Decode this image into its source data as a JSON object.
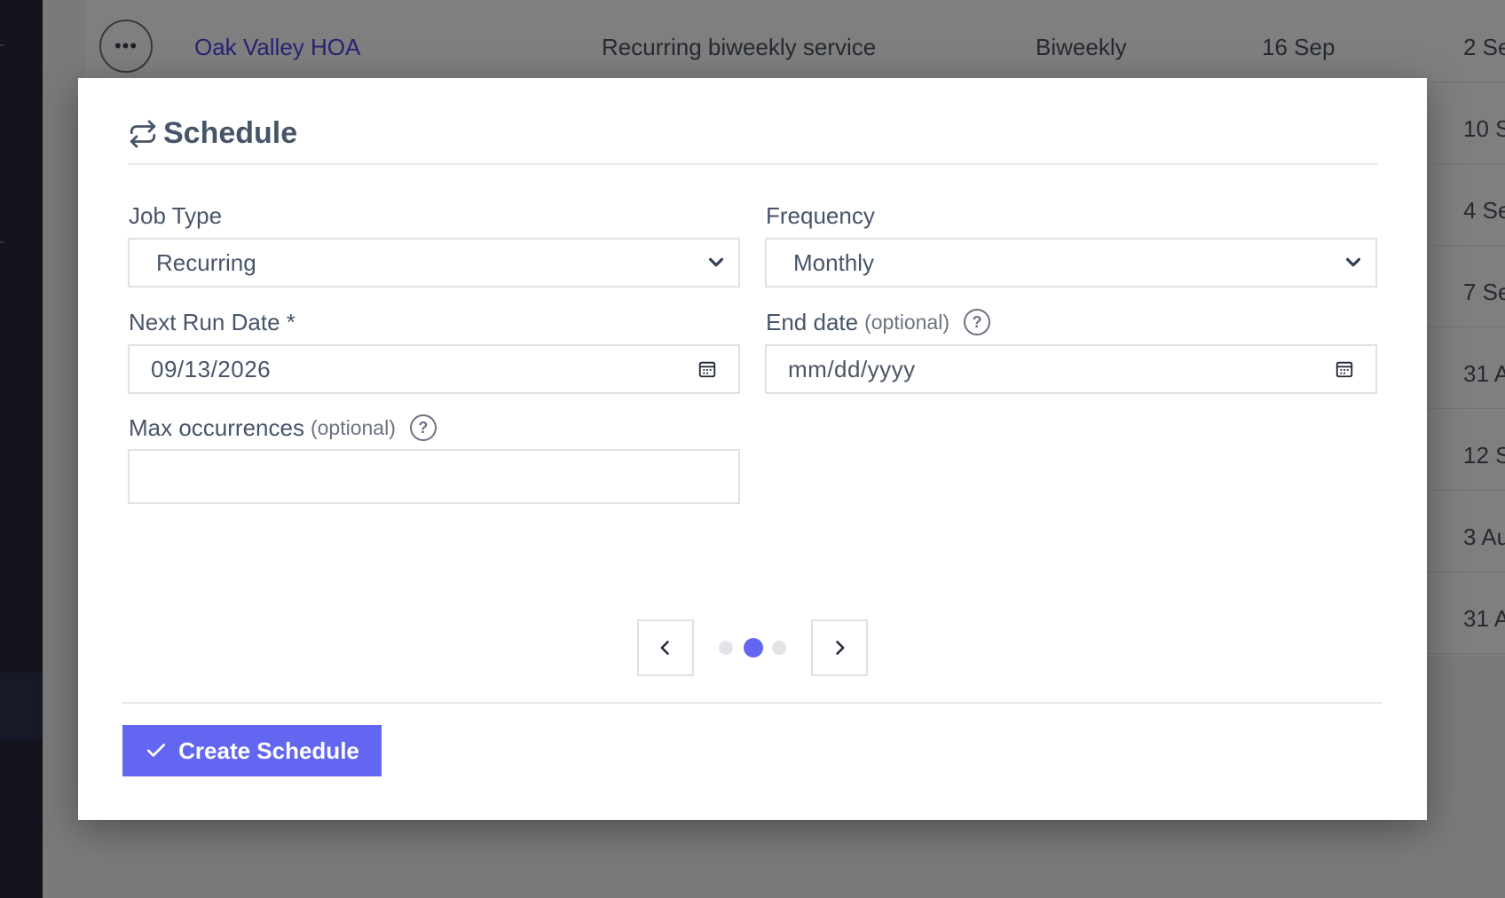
{
  "background": {
    "rows": [
      {
        "customer": "Oak Valley HOA",
        "description": "Recurring biweekly service",
        "frequency": "Biweekly",
        "next_run": "16 Sep",
        "last_cell": "2 Se"
      },
      {
        "last_cell": "10 S"
      },
      {
        "last_cell": "4 Se"
      },
      {
        "last_cell": "7 Se"
      },
      {
        "last_cell": "31 A"
      },
      {
        "last_cell": "12 S"
      },
      {
        "last_cell": "3 Au"
      },
      {
        "last_cell": "31 A"
      }
    ]
  },
  "modal": {
    "title": "Schedule",
    "title_icon": "repeat-icon",
    "job_type": {
      "label": "Job Type",
      "value": "Recurring"
    },
    "frequency": {
      "label": "Frequency",
      "value": "Monthly"
    },
    "next_run_date": {
      "label": "Next Run Date *",
      "value": "09/13/2026"
    },
    "end_date": {
      "label": "End date",
      "optional": "(optional)",
      "placeholder": "mm/dd/yyyy",
      "help": "?"
    },
    "max_occurrences": {
      "label": "Max occurrences",
      "optional": "(optional)",
      "value": "",
      "help": "?"
    },
    "pager": {
      "total_steps": 3,
      "current_step": 2
    },
    "submit_label": "Create Schedule"
  },
  "colors": {
    "accent": "#6366f1",
    "link": "#4f46e5",
    "label": "#475569",
    "border": "#dfe1e6",
    "sidebar": "#26283a"
  }
}
